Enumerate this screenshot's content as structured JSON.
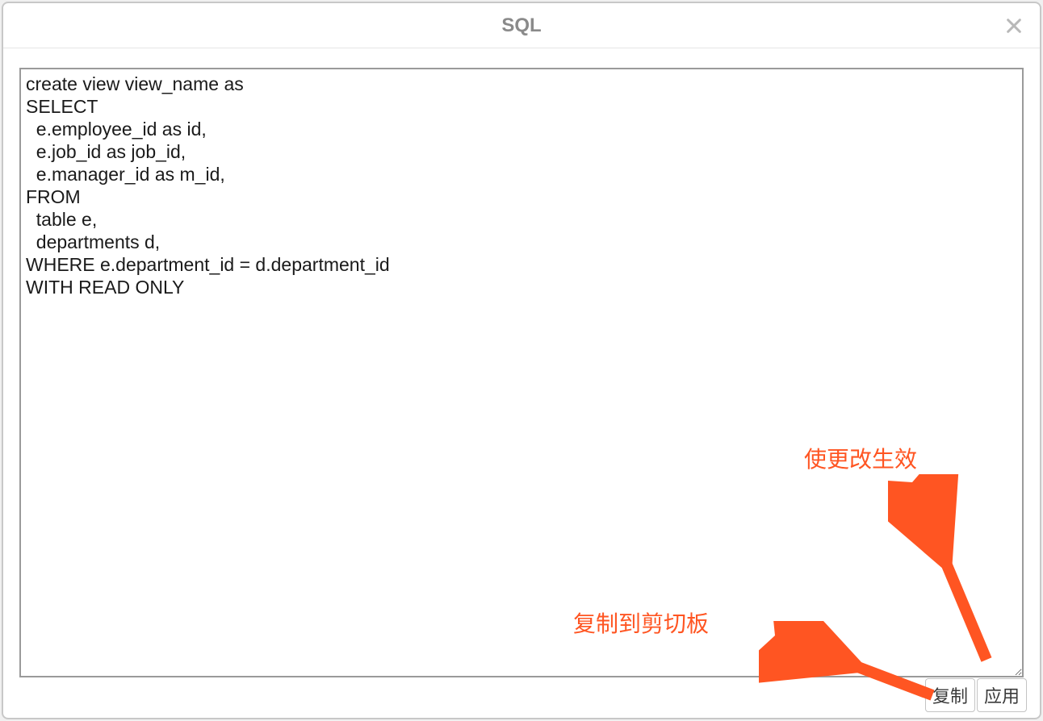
{
  "dialog": {
    "title": "SQL",
    "close_label": "×"
  },
  "editor": {
    "sql_text": "create view view_name as\nSELECT\n  e.employee_id as id,\n  e.job_id as job_id,\n  e.manager_id as m_id,\nFROM\n  table e,\n  departments d,\nWHERE e.department_id = d.department_id\nWITH READ ONLY"
  },
  "footer": {
    "copy_label": "复制",
    "apply_label": "应用"
  },
  "annotations": {
    "apply_hint": "使更改生效",
    "copy_hint": "复制到剪切板"
  },
  "colors": {
    "accent": "#ff5522",
    "title": "#8a8a8a",
    "border": "#c8c8c8"
  }
}
